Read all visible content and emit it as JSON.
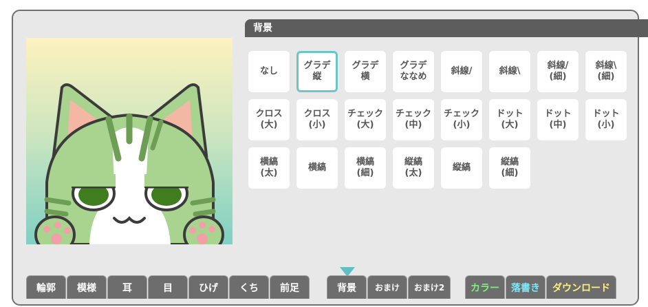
{
  "panel": {
    "title": "背景"
  },
  "options": [
    {
      "label": "なし"
    },
    {
      "label": "グラデ\n縦",
      "selected": true
    },
    {
      "label": "グラデ\n横"
    },
    {
      "label": "グラデ\nななめ"
    },
    {
      "label": "斜線/"
    },
    {
      "label": "斜線\\"
    },
    {
      "label": "斜線/\n(細)"
    },
    {
      "label": "斜線\\\n(細)"
    },
    {
      "label": "クロス\n(大)"
    },
    {
      "label": "クロス\n(小)"
    },
    {
      "label": "チェック\n(大)"
    },
    {
      "label": "チェック\n(中)"
    },
    {
      "label": "チェック\n(小)"
    },
    {
      "label": "ドット\n(大)"
    },
    {
      "label": "ドット\n(中)"
    },
    {
      "label": "ドット\n(小)"
    },
    {
      "label": "横縞\n(太)"
    },
    {
      "label": "横縞"
    },
    {
      "label": "横縞\n(細)"
    },
    {
      "label": "縦縞\n(太)"
    },
    {
      "label": "縦縞"
    },
    {
      "label": "縦縞\n(細)"
    }
  ],
  "tabs": [
    {
      "label": "輪郭"
    },
    {
      "label": "模様"
    },
    {
      "label": "耳"
    },
    {
      "label": "目"
    },
    {
      "label": "ひげ"
    },
    {
      "label": "くち"
    },
    {
      "label": "前足"
    },
    {
      "label": "背景",
      "active": true
    },
    {
      "label": "おまけ"
    },
    {
      "label": "おまけ2"
    },
    {
      "label": "カラー"
    },
    {
      "label": "落書き"
    },
    {
      "label": "ダウンロード"
    }
  ],
  "colors": {
    "accent": "#6cc6c8",
    "tab_bg": "#6d6d6d",
    "header_bg": "#5d5d5d",
    "cat_green": "#a9d48f",
    "cat_stripe": "#6e9e55",
    "eye": "#3f7d1e",
    "ear_inner": "#f3b7a3"
  },
  "preview": {
    "background": "グラデ縦"
  }
}
